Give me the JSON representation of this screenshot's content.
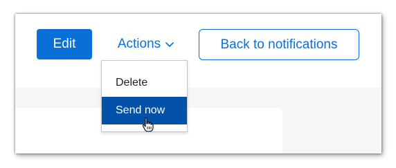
{
  "toolbar": {
    "edit_label": "Edit",
    "actions_label": "Actions",
    "back_label": "Back to notifications"
  },
  "actions_menu": {
    "items": [
      {
        "label": "Delete",
        "highlighted": false
      },
      {
        "label": "Send now",
        "highlighted": true
      }
    ]
  },
  "colors": {
    "primary": "#0a6fd8",
    "menu_highlight": "#0351a8",
    "content_background": "#f5f6f8"
  },
  "icons": {
    "actions_chevron": "chevron-down-icon",
    "cursor": "hand-pointer-icon"
  }
}
